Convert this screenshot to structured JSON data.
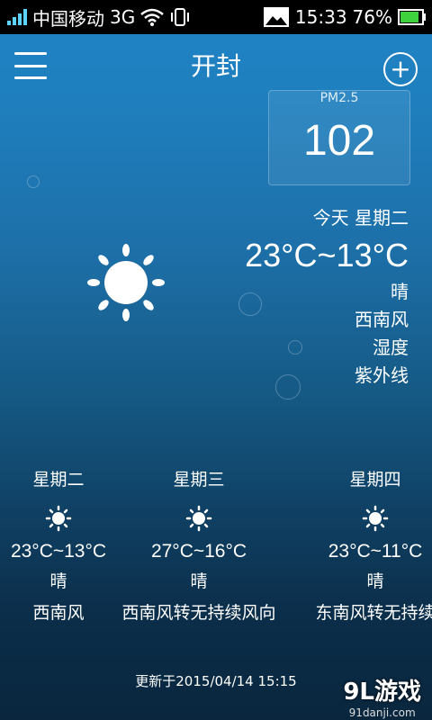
{
  "status_bar": {
    "carrier": "中国移动",
    "network": "3G",
    "time": "15:33",
    "battery": "76%"
  },
  "header": {
    "city": "开封"
  },
  "pm25": {
    "label": "PM2.5",
    "value": "102"
  },
  "today": {
    "day": "今天  星期二",
    "temp": "23°C~13°C",
    "condition": "晴",
    "wind": "西南风",
    "humidity_label": "湿度",
    "uv_label": "紫外线"
  },
  "forecast": [
    {
      "day": "星期二",
      "temp": "23°C~13°C",
      "condition": "晴",
      "wind": "西南风"
    },
    {
      "day": "星期三",
      "temp": "27°C~16°C",
      "condition": "晴",
      "wind": "西南风转无持续风向"
    },
    {
      "day": "星期四",
      "temp": "23°C~11°C",
      "condition": "晴",
      "wind": "东南风转无持续"
    }
  ],
  "updated": "更新于2015/04/14 15:15",
  "watermark": {
    "main": "9L游戏",
    "sub": "91danji.com"
  },
  "colors": {
    "accent": "#5dd3ff",
    "battery": "#3fd23f"
  }
}
